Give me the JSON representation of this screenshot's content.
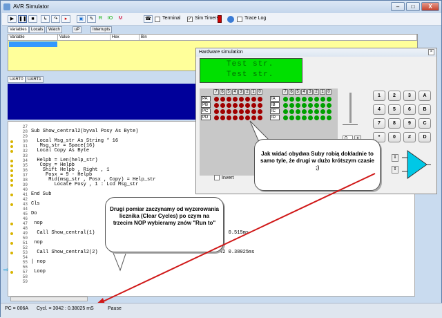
{
  "window": {
    "title": "AVR Simulator",
    "min": "–",
    "max": "□",
    "close": "X"
  },
  "toolbar": {
    "icons": [
      "play-icon",
      "pause-icon",
      "stop-icon",
      "step-into-icon",
      "step-over-icon",
      "run-to-icon",
      "hardware-sim-icon",
      "settings-icon",
      "r-icon",
      "io-icon",
      "m-icon",
      "terminal-icon",
      "sim-timers-icon",
      "trace-icon"
    ],
    "terminal_label": "Terminal",
    "sim_timers_label": "Sim Timers",
    "trace_log_label": "Trace Log",
    "sim_timers_checked": true
  },
  "top_tabs": [
    "Variables",
    "Locals",
    "Watch",
    "uP",
    "Interrupts"
  ],
  "grid_headers": [
    "Variable",
    "Value",
    "Hex",
    "Bin"
  ],
  "uart_tabs": [
    "UART0",
    "UART1"
  ],
  "code_lines": [
    {
      "n": "27",
      "t": "",
      "m": false
    },
    {
      "n": "28",
      "t": "Sub Show_central2(byval Posy As Byte)",
      "m": false
    },
    {
      "n": "29",
      "t": "",
      "m": false
    },
    {
      "n": "30",
      "t": "  Local Msg_str As String * 16",
      "m": true
    },
    {
      "n": "31",
      "t": "   Msg_str = Space(16)",
      "m": true
    },
    {
      "n": "32",
      "t": "  Local Copy As Byte",
      "m": true
    },
    {
      "n": "33",
      "t": "",
      "m": false
    },
    {
      "n": "34",
      "t": "  Helpb = Len(help_str)",
      "m": true
    },
    {
      "n": "35",
      "t": "   Copy = Helpb",
      "m": true
    },
    {
      "n": "36",
      "t": "    Shift Helpb , Right , 1",
      "m": true
    },
    {
      "n": "37",
      "t": "     Posx = 9 - Helpb",
      "m": true
    },
    {
      "n": "38",
      "t": "      Mid(msg_str , Posx , Copy) = Help_str",
      "m": true
    },
    {
      "n": "39",
      "t": "        Locate Posy , 1 : Lcd Msg_str",
      "m": true
    },
    {
      "n": "40",
      "t": "",
      "m": false
    },
    {
      "n": "41",
      "t": "End Sub",
      "m": true
    },
    {
      "n": "42",
      "t": "",
      "m": false
    },
    {
      "n": "43",
      "t": "Cls",
      "m": true
    },
    {
      "n": "44",
      "t": "",
      "m": false
    },
    {
      "n": "45",
      "t": "Do",
      "m": false
    },
    {
      "n": "46",
      "t": "",
      "m": false
    },
    {
      "n": "47",
      "t": " nop",
      "m": true
    },
    {
      "n": "48",
      "t": "",
      "m": false
    },
    {
      "n": "49",
      "t": "  Call Show_central(1)                                        '4120 0.515ms",
      "m": true
    },
    {
      "n": "50",
      "t": "",
      "m": false
    },
    {
      "n": "51",
      "t": " nop",
      "m": true
    },
    {
      "n": "52",
      "t": "",
      "m": false
    },
    {
      "n": "53",
      "t": "  Call Show_central2(2)                                       '3042 0.38025ms",
      "m": true
    },
    {
      "n": "54",
      "t": "",
      "m": false
    },
    {
      "n": "55",
      "t": "| nop",
      "m": false
    },
    {
      "n": "56",
      "t": "",
      "m": false
    },
    {
      "n": "57",
      "t": " Loop",
      "m": true
    },
    {
      "n": "58",
      "t": "",
      "m": false
    },
    {
      "n": "59",
      "t": "",
      "m": false
    }
  ],
  "hw": {
    "title": "Hardware simulation",
    "lcd_line1": "Test str.",
    "lcd_line2": "Test str.",
    "bits": [
      "7",
      "6",
      "5",
      "4",
      "3",
      "2",
      "1",
      "0"
    ],
    "ports_left": [
      "PA",
      "PB",
      "PC",
      "PD"
    ],
    "ports_right": [
      "IA",
      "IB",
      "IC",
      "ID"
    ],
    "invert_label": "Invert",
    "slider_value": "0",
    "val1": "00",
    "val2": "00",
    "keys": [
      "1",
      "2",
      "3",
      "A",
      "4",
      "5",
      "6",
      "B",
      "7",
      "8",
      "9",
      "C",
      "*",
      "0",
      "#",
      "D"
    ]
  },
  "bubbles": {
    "b1": "Jak widać obydwa Suby robią dokładnie to samo tyle, że drugi w dużo krótszym czasie ;)",
    "b2": "Drugi pomiar zaczynamy od wyzerowania licznika (Clear Cycles) po czym na trzecim NOP wybieramy znów \"Run to\""
  },
  "status": {
    "pc": "PC = 006A",
    "cycles": "Cycl. = 3042 : 0.38025 mS",
    "state": "Pause"
  },
  "colors": {
    "led_on": "#00a000",
    "led_off": "#a00000",
    "lcd": "#00e000",
    "uart": "#00009a",
    "watch": "#ffff9a"
  }
}
